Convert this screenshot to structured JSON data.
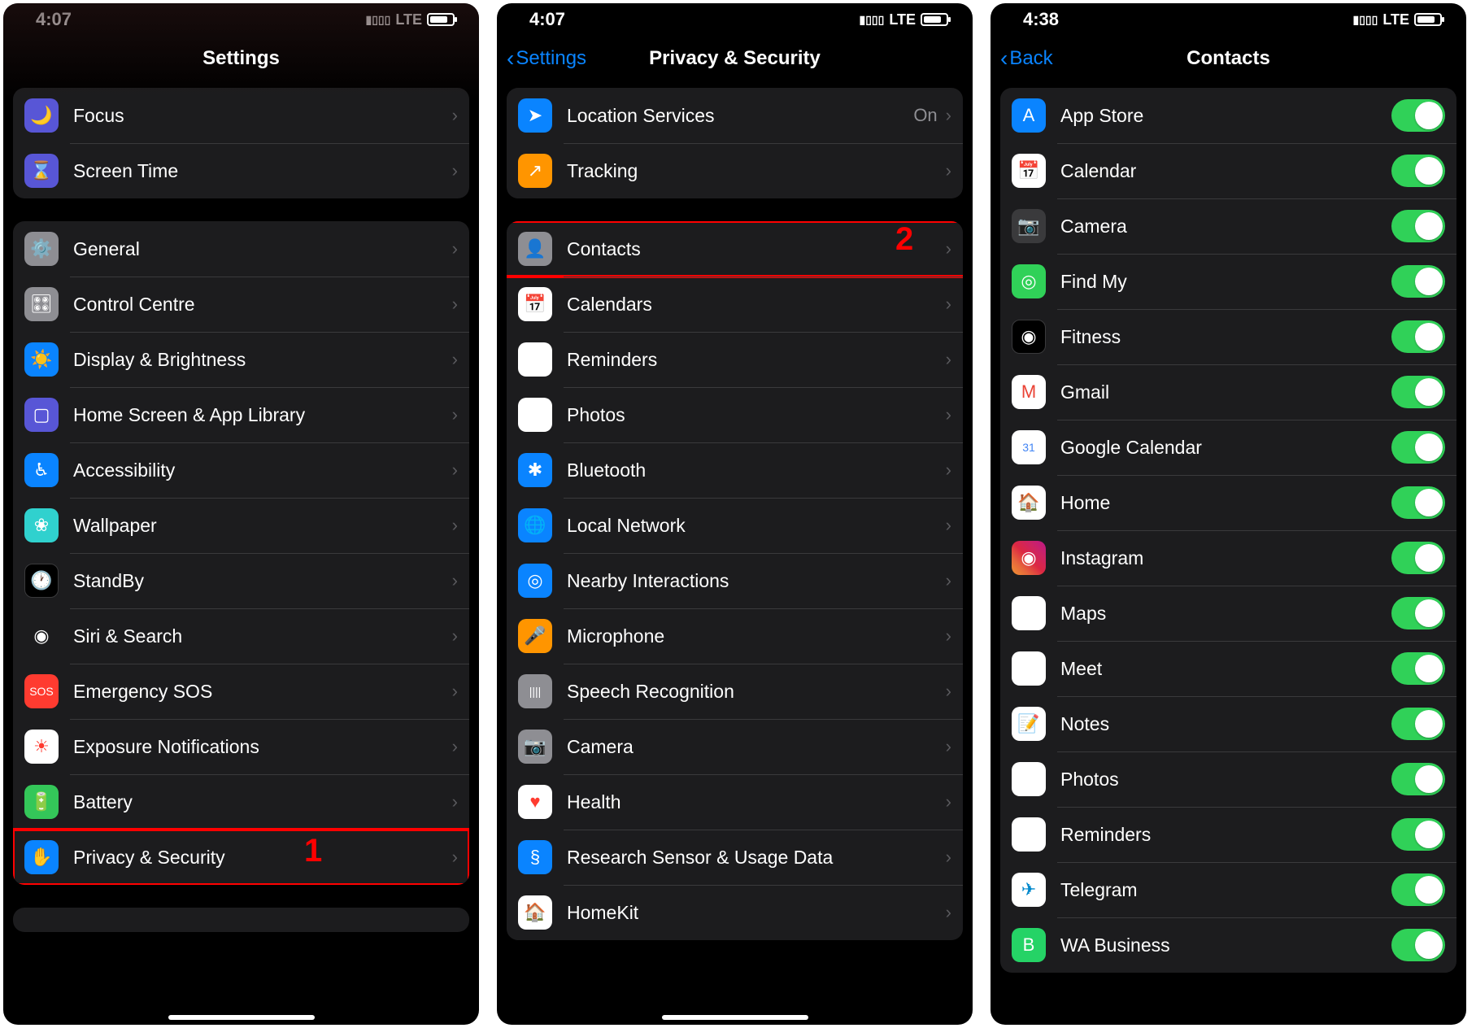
{
  "screen1": {
    "time": "4:07",
    "network": "LTE",
    "title": "Settings",
    "callout": "1",
    "groups": [
      [
        {
          "icon": "🌙",
          "bg": "#5856d6",
          "label": "Focus"
        },
        {
          "icon": "⌛",
          "bg": "#5856d6",
          "label": "Screen Time"
        }
      ],
      [
        {
          "icon": "⚙️",
          "bg": "#8e8e93",
          "label": "General"
        },
        {
          "icon": "🎛",
          "bg": "#8e8e93",
          "label": "Control Centre"
        },
        {
          "icon": "☀️",
          "bg": "#0a84ff",
          "label": "Display & Brightness"
        },
        {
          "icon": "▢",
          "bg": "#5856d6",
          "label": "Home Screen & App Library"
        },
        {
          "icon": "♿︎",
          "bg": "#0a84ff",
          "label": "Accessibility"
        },
        {
          "icon": "❀",
          "bg": "#30d1ce",
          "label": "Wallpaper"
        },
        {
          "icon": "🕐",
          "bg": "#000",
          "label": "StandBy"
        },
        {
          "icon": "◉",
          "bg": "#1c1c1e",
          "label": "Siri & Search"
        },
        {
          "icon": "SOS",
          "bg": "#ff3b30",
          "label": "Emergency SOS",
          "small": true
        },
        {
          "icon": "☀︎",
          "bg": "#fff",
          "fg": "#ff3b30",
          "label": "Exposure Notifications"
        },
        {
          "icon": "🔋",
          "bg": "#34c759",
          "label": "Battery"
        },
        {
          "icon": "✋",
          "bg": "#0a84ff",
          "label": "Privacy & Security",
          "highlight": true
        }
      ]
    ]
  },
  "screen2": {
    "time": "4:07",
    "network": "LTE",
    "back": "Settings",
    "title": "Privacy & Security",
    "callout": "2",
    "groups": [
      [
        {
          "icon": "➤",
          "bg": "#0a84ff",
          "label": "Location Services",
          "value": "On"
        },
        {
          "icon": "↗",
          "bg": "#ff9500",
          "label": "Tracking"
        }
      ],
      [
        {
          "icon": "👤",
          "bg": "#8e8e93",
          "label": "Contacts",
          "highlight": true
        },
        {
          "icon": "📅",
          "bg": "#fff",
          "label": "Calendars"
        },
        {
          "icon": "☰",
          "bg": "#fff",
          "label": "Reminders"
        },
        {
          "icon": "✿",
          "bg": "#fff",
          "label": "Photos"
        },
        {
          "icon": "✱",
          "bg": "#0a84ff",
          "label": "Bluetooth"
        },
        {
          "icon": "🌐",
          "bg": "#0a84ff",
          "label": "Local Network"
        },
        {
          "icon": "◎",
          "bg": "#0a84ff",
          "label": "Nearby Interactions"
        },
        {
          "icon": "🎤",
          "bg": "#ff9500",
          "label": "Microphone"
        },
        {
          "icon": "||||",
          "bg": "#8e8e93",
          "label": "Speech Recognition",
          "small": true
        },
        {
          "icon": "📷",
          "bg": "#8e8e93",
          "label": "Camera"
        },
        {
          "icon": "♥",
          "bg": "#fff",
          "fg": "#ff3b30",
          "label": "Health"
        },
        {
          "icon": "§",
          "bg": "#0a84ff",
          "label": "Research Sensor & Usage Data"
        },
        {
          "icon": "🏠",
          "bg": "#fff",
          "fg": "#ff9500",
          "label": "HomeKit"
        }
      ]
    ]
  },
  "screen3": {
    "time": "4:38",
    "network": "LTE",
    "back": "Back",
    "title": "Contacts",
    "rows": [
      {
        "icon": "A",
        "bg": "#0a84ff",
        "label": "App Store"
      },
      {
        "icon": "📅",
        "bg": "#fff",
        "label": "Calendar"
      },
      {
        "icon": "📷",
        "bg": "#3a3a3c",
        "label": "Camera"
      },
      {
        "icon": "◎",
        "bg": "#30d158",
        "label": "Find My"
      },
      {
        "icon": "◉",
        "bg": "#000",
        "label": "Fitness"
      },
      {
        "icon": "M",
        "bg": "#fff",
        "fg": "#ea4335",
        "label": "Gmail"
      },
      {
        "icon": "31",
        "bg": "#fff",
        "fg": "#4285f4",
        "label": "Google Calendar",
        "small": true
      },
      {
        "icon": "🏠",
        "bg": "#fff",
        "fg": "#ff9500",
        "label": "Home"
      },
      {
        "icon": "◉",
        "bg": "linear-gradient(45deg,#f09433,#e6683c,#dc2743,#cc2366,#bc1888)",
        "label": "Instagram"
      },
      {
        "icon": "🗺",
        "bg": "#fff",
        "label": "Maps"
      },
      {
        "icon": "▣",
        "bg": "#fff",
        "label": "Meet"
      },
      {
        "icon": "📝",
        "bg": "#fff",
        "label": "Notes"
      },
      {
        "icon": "✿",
        "bg": "#fff",
        "label": "Photos"
      },
      {
        "icon": "☰",
        "bg": "#fff",
        "label": "Reminders"
      },
      {
        "icon": "✈",
        "bg": "#fff",
        "fg": "#0088cc",
        "label": "Telegram"
      },
      {
        "icon": "B",
        "bg": "#25d366",
        "label": "WA Business"
      }
    ]
  }
}
